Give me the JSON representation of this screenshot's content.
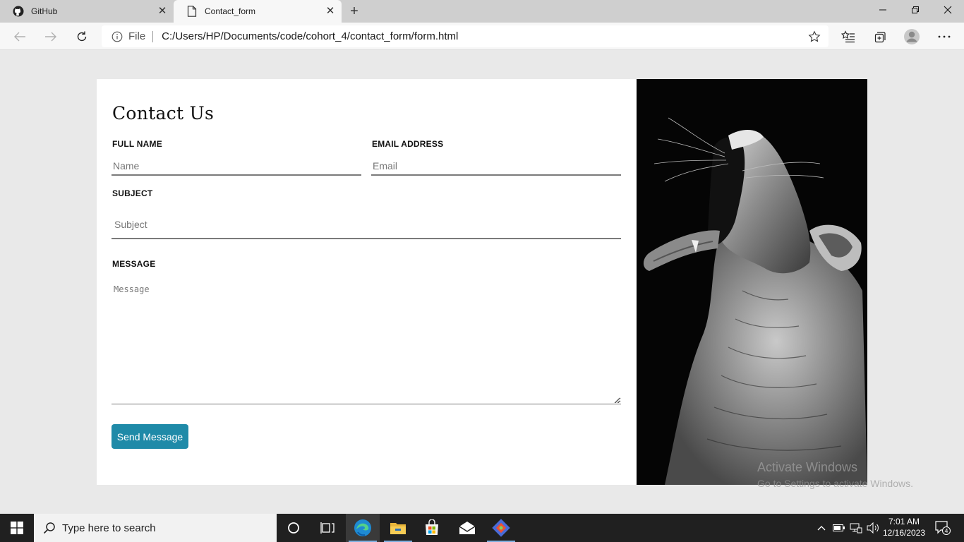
{
  "browser": {
    "tabs": [
      {
        "label": "GitHub",
        "icon": "github-icon",
        "active": false
      },
      {
        "label": "Contact_form",
        "icon": "page-icon",
        "active": true
      }
    ],
    "address": {
      "scheme_label": "File",
      "url": "C:/Users/HP/Documents/code/cohort_4/contact_form/form.html"
    }
  },
  "form": {
    "title": "Contact Us",
    "full_name_label": "FULL NAME",
    "full_name_placeholder": "Name",
    "email_label": "EMAIL ADDRESS",
    "email_placeholder": "Email",
    "subject_label": "SUBJECT",
    "subject_placeholder": "Subject",
    "message_label": "MESSAGE",
    "message_placeholder": "Message",
    "submit_label": "Send Message",
    "button_color": "#1f8aa8"
  },
  "watermark": {
    "line1": "Activate Windows",
    "line2": "Go to Settings to activate Windows."
  },
  "taskbar": {
    "search_placeholder": "Type here to search",
    "time": "7:01 AM",
    "date": "12/16/2023",
    "notification_count": "4"
  }
}
